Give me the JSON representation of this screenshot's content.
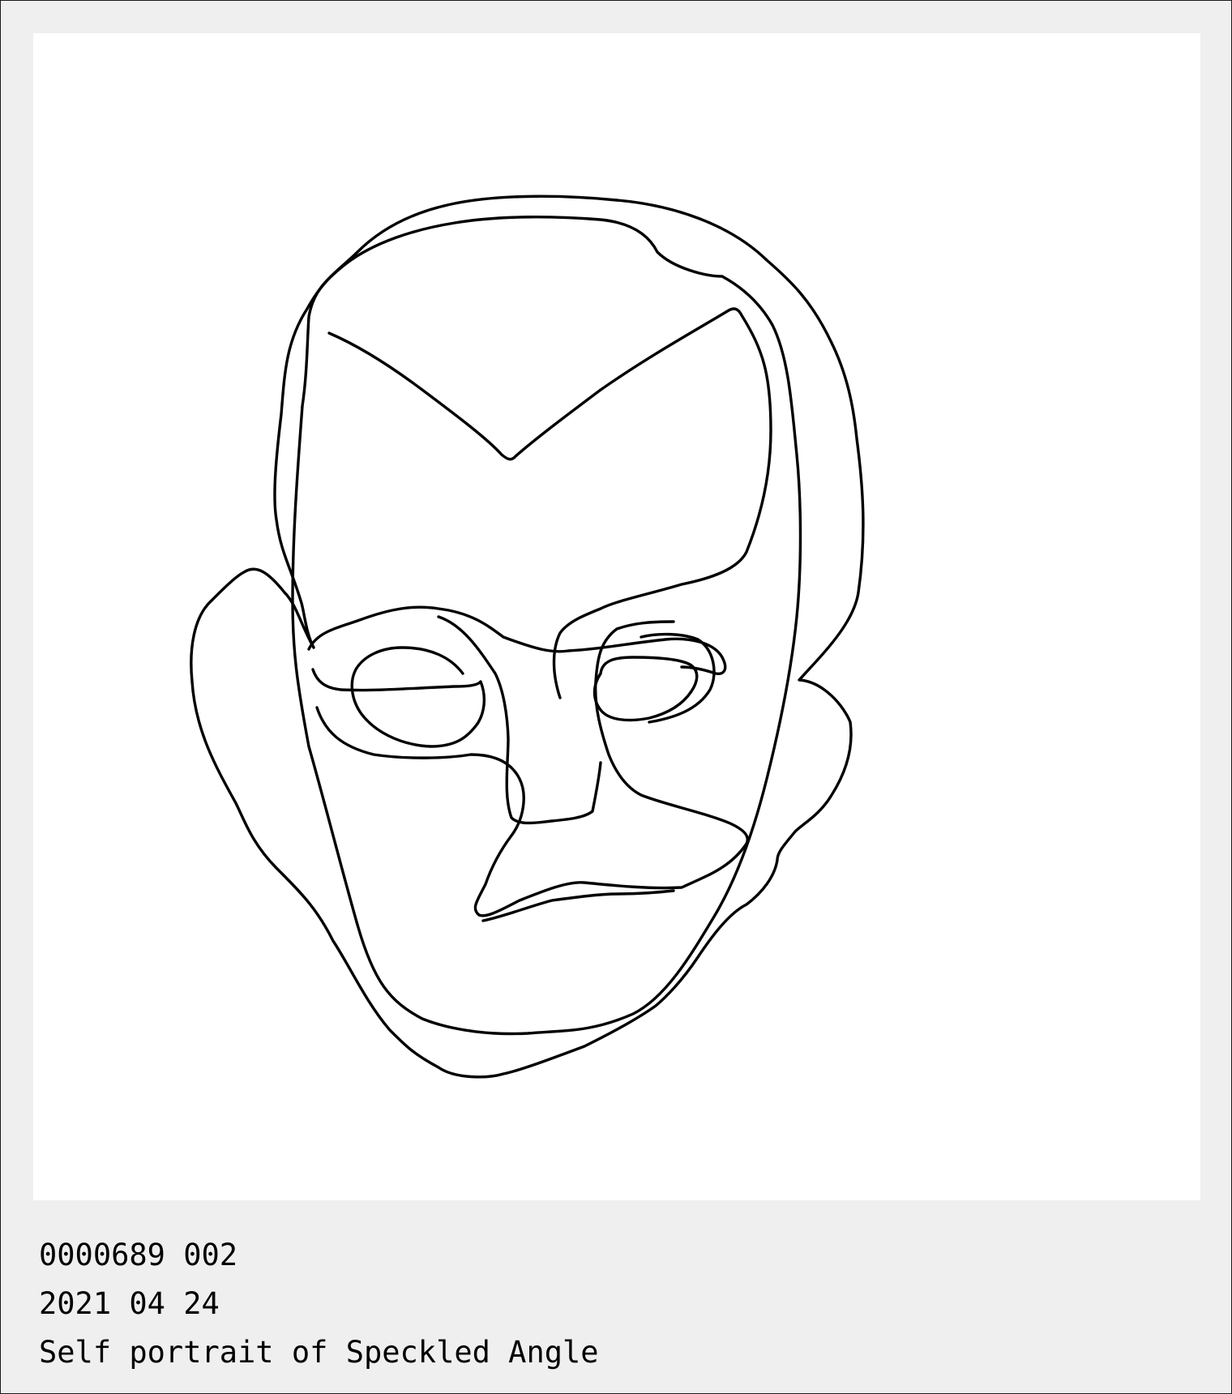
{
  "artwork": {
    "id_line": "0000689 002",
    "date_line": "2021 04 24",
    "title": "Self portrait of Speckled Angle"
  }
}
